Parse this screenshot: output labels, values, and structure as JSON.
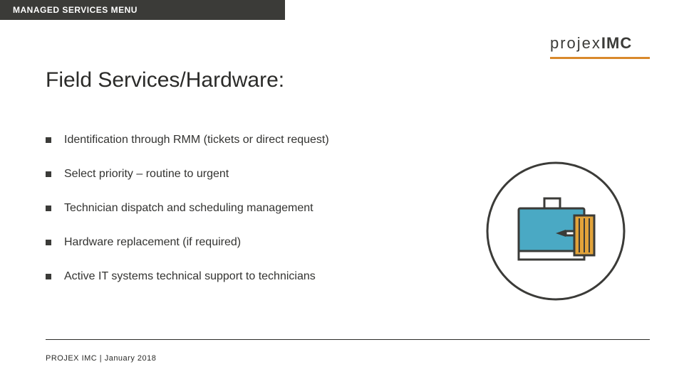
{
  "header": {
    "tab": "MANAGED SERVICES MENU"
  },
  "logo": {
    "prefix": "projex",
    "suffix": "IMC"
  },
  "title": "Field Services/Hardware:",
  "bullets": [
    "Identification through RMM (tickets or direct request)",
    "Select priority – routine to urgent",
    "Technician dispatch and scheduling management",
    "Hardware replacement (if required)",
    "Active IT systems technical support to technicians"
  ],
  "footer": {
    "text": "PROJEX IMC  |  January 2018"
  },
  "graphic": {
    "name": "briefcase-monitor-screwdriver-icon"
  }
}
